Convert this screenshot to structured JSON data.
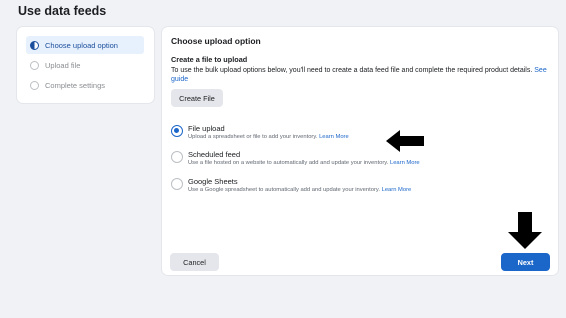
{
  "page": {
    "title": "Use data feeds"
  },
  "steps": [
    {
      "label": "Choose upload option",
      "state": "active"
    },
    {
      "label": "Upload file",
      "state": "pending"
    },
    {
      "label": "Complete settings",
      "state": "pending"
    }
  ],
  "main": {
    "section_title": "Choose upload option",
    "create_title": "Create a file to upload",
    "create_desc": "To use the bulk upload options below, you'll need to create a data feed file and complete the required product details.",
    "see_guide": "See guide",
    "create_button": "Create File",
    "options": [
      {
        "label": "File upload",
        "desc": "Upload a spreadsheet or file to add your inventory.",
        "link": "Learn More",
        "selected": true
      },
      {
        "label": "Scheduled feed",
        "desc": "Use a file hosted on a website to automatically add and update your inventory.",
        "link": "Learn More",
        "selected": false
      },
      {
        "label": "Google Sheets",
        "desc": "Use a Google spreadsheet to automatically add and update your inventory.",
        "link": "Learn More",
        "selected": false
      }
    ],
    "cancel_button": "Cancel",
    "next_button": "Next"
  },
  "colors": {
    "accent": "#1b66c9",
    "active_step_bg": "#e7f0fd",
    "page_bg": "#f0f2f5"
  }
}
